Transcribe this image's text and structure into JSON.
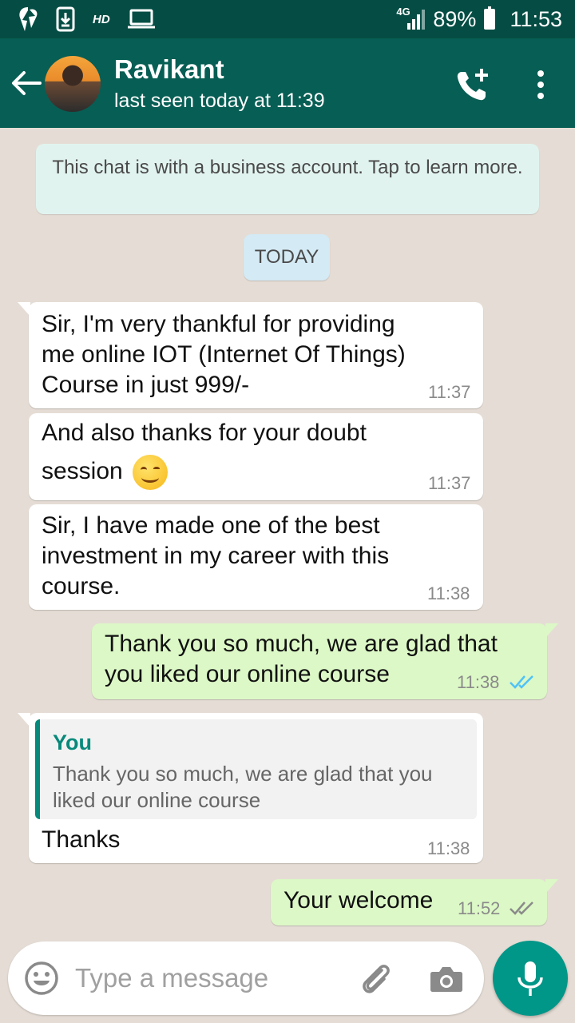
{
  "status_bar": {
    "hd_label": "HD",
    "network": "4G",
    "battery": "89%",
    "time": "11:53"
  },
  "header": {
    "contact_name": "Ravikant",
    "last_seen": "last seen today at 11:39"
  },
  "chat": {
    "business_notice": "This chat is with a business account. Tap to learn more.",
    "date_label": "TODAY",
    "messages": [
      {
        "direction": "in",
        "lines": [
          "Sir, I'm very thankful for providing",
          "me online IOT (Internet Of Things)",
          "Course in just 999/-"
        ],
        "time": "11:37"
      },
      {
        "direction": "in",
        "lines": [
          "And also thanks for your doubt",
          "session"
        ],
        "emoji": "smiling-face",
        "time": "11:37"
      },
      {
        "direction": "in",
        "lines": [
          "Sir, I have made one of the best",
          "investment in my career with this",
          "course."
        ],
        "time": "11:38"
      },
      {
        "direction": "out",
        "lines": [
          "Thank you so much, we are glad that",
          "you liked our online course"
        ],
        "time": "11:38",
        "ticks": "double-blue"
      },
      {
        "direction": "in",
        "quote": {
          "author": "You",
          "text": "Thank you so much, we are glad that you liked our online course"
        },
        "lines": [
          "Thanks"
        ],
        "time": "11:38"
      },
      {
        "direction": "out",
        "lines": [
          "Your welcome"
        ],
        "time": "11:52",
        "ticks": "double-grey"
      }
    ]
  },
  "input": {
    "placeholder": "Type a message"
  },
  "colors": {
    "header": "#075e54",
    "status_bar": "#054d44",
    "outgoing_bubble": "#dcf8c6",
    "incoming_bubble": "#ffffff",
    "read_ticks": "#4fc3f7",
    "accent": "#009688"
  },
  "icons": [
    "back-arrow-icon",
    "add-call-icon",
    "more-vert-icon",
    "emoji-icon",
    "attach-icon",
    "camera-icon",
    "mic-icon"
  ]
}
